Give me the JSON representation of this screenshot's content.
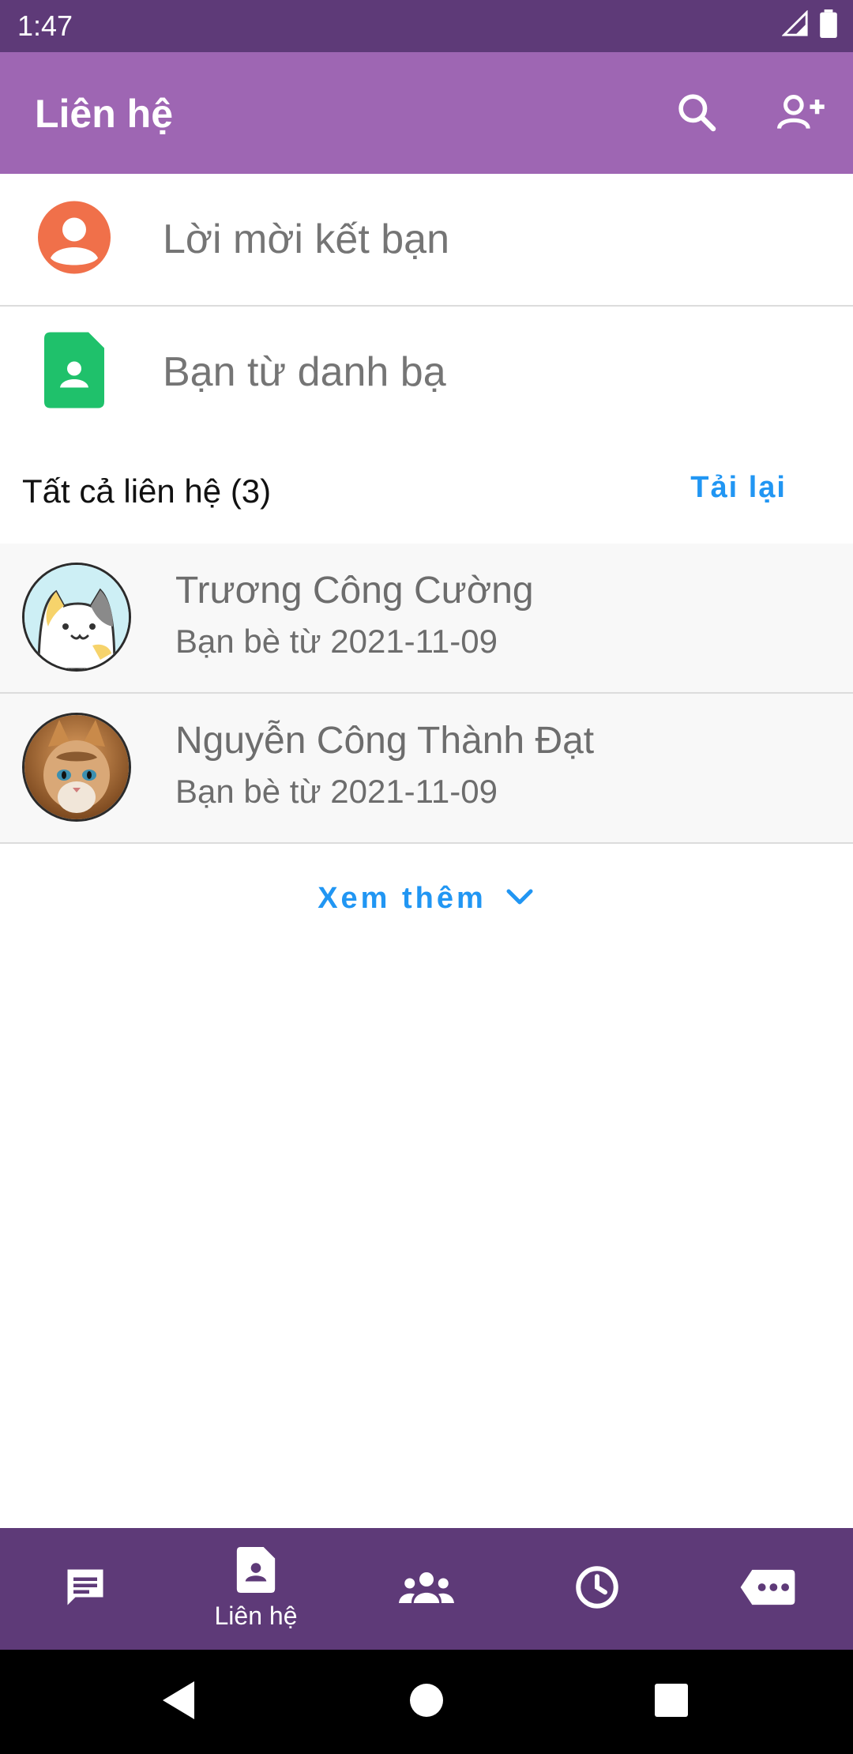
{
  "status_bar": {
    "time": "1:47"
  },
  "app_bar": {
    "title": "Liên hệ",
    "actions": [
      "search-icon",
      "add-person-icon"
    ]
  },
  "menu": {
    "friend_requests": "Lời mời kết bạn",
    "phonebook_friends": "Bạn từ danh bạ"
  },
  "contacts_section": {
    "title": "Tất cả liên hệ (3)",
    "reload": "Tải lại",
    "items": [
      {
        "name": "Trương Công Cường",
        "since": "Bạn bè từ 2021-11-09",
        "avatar": "cartoon-cat-avatar"
      },
      {
        "name": "Nguyễn Công Thành Đạt",
        "since": "Bạn bè từ 2021-11-09",
        "avatar": "kitten-photo-avatar"
      }
    ],
    "more": "Xem thêm"
  },
  "tab_bar": {
    "tabs": [
      {
        "icon": "chat-icon",
        "label": ""
      },
      {
        "icon": "contact-card-icon",
        "label": "Liên hệ",
        "active": true
      },
      {
        "icon": "groups-icon",
        "label": ""
      },
      {
        "icon": "clock-icon",
        "label": ""
      },
      {
        "icon": "more-icon",
        "label": ""
      }
    ]
  },
  "colors": {
    "status_bar": "#5e3a78",
    "app_bar": "#9e66b3",
    "accent": "#2196f3",
    "friend_request_icon": "#f0704a",
    "phonebook_icon": "#1fc16b"
  }
}
